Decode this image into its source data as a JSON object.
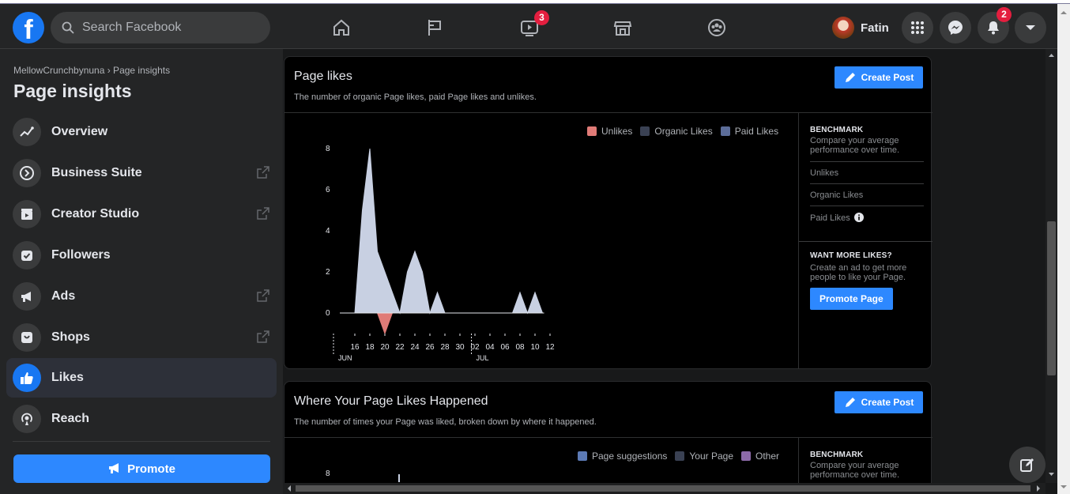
{
  "topbar": {
    "search_placeholder": "Search Facebook",
    "watch_badge": "3",
    "profile_name": "Fatin",
    "notifications_badge": "2"
  },
  "sidebar": {
    "breadcrumb": "MellowCrunchbynuna › Page insights",
    "title": "Page insights",
    "items": [
      {
        "label": "Overview"
      },
      {
        "label": "Business Suite"
      },
      {
        "label": "Creator Studio"
      },
      {
        "label": "Followers"
      },
      {
        "label": "Ads"
      },
      {
        "label": "Shops"
      },
      {
        "label": "Likes"
      },
      {
        "label": "Reach"
      }
    ],
    "promote_label": "Promote"
  },
  "page_likes_card": {
    "title": "Page likes",
    "subtitle": "The number of organic Page likes, paid Page likes and unlikes.",
    "create_post_label": "Create Post",
    "legend": [
      "Unlikes",
      "Organic Likes",
      "Paid Likes"
    ],
    "benchmark": {
      "heading": "BENCHMARK",
      "desc": "Compare your average performance over time.",
      "rows": [
        "Unlikes",
        "Organic Likes",
        "Paid Likes"
      ]
    },
    "more_likes": {
      "heading": "WANT MORE LIKES?",
      "desc": "Create an ad to get more people to like your Page.",
      "button": "Promote Page"
    }
  },
  "where_likes_card": {
    "title": "Where Your Page Likes Happened",
    "subtitle": "The number of times your Page was liked, broken down by where it happened.",
    "create_post_label": "Create Post",
    "legend": [
      "Page suggestions",
      "Your Page",
      "Other"
    ],
    "benchmark": {
      "heading": "BENCHMARK",
      "desc": "Compare your average performance over time."
    },
    "y_tick_top": "8"
  },
  "chart_data": {
    "type": "area",
    "title": "Page likes",
    "x_tick_labels": [
      "16",
      "18",
      "20",
      "22",
      "24",
      "26",
      "28",
      "30",
      "02",
      "04",
      "06",
      "08",
      "10",
      "12"
    ],
    "month_labels": [
      "JUN",
      "JUL"
    ],
    "yticks": [
      "0",
      "2",
      "4",
      "6",
      "8"
    ],
    "ylim": [
      -1,
      8.5
    ],
    "x": [
      "Jun 14",
      "Jun 15",
      "Jun 16",
      "Jun 17",
      "Jun 18",
      "Jun 19",
      "Jun 20",
      "Jun 21",
      "Jun 22",
      "Jun 23",
      "Jun 24",
      "Jun 25",
      "Jun 26",
      "Jun 27",
      "Jun 28",
      "Jun 29",
      "Jun 30",
      "Jul 01",
      "Jul 02",
      "Jul 03",
      "Jul 04",
      "Jul 05",
      "Jul 06",
      "Jul 07",
      "Jul 08",
      "Jul 09",
      "Jul 10",
      "Jul 11"
    ],
    "series": [
      {
        "name": "Organic Likes",
        "color": "#c8d0e2",
        "values": [
          0,
          0,
          0,
          5,
          8,
          3,
          2,
          1,
          0,
          2,
          3,
          2,
          0,
          1,
          0,
          0,
          0,
          0,
          0,
          0,
          0,
          0,
          0,
          0,
          1,
          0,
          1,
          0
        ]
      },
      {
        "name": "Unlikes",
        "color": "#e07b77",
        "values": [
          0,
          0,
          0,
          0,
          0,
          0,
          -1,
          0,
          0,
          0,
          0,
          0,
          0,
          0,
          0,
          0,
          0,
          0,
          0,
          0,
          0,
          0,
          0,
          0,
          0,
          0,
          0,
          0
        ]
      },
      {
        "name": "Paid Likes",
        "color": "#5c6d99",
        "values": [
          0,
          0,
          0,
          0,
          0,
          0,
          0,
          0,
          0,
          0,
          0,
          0,
          0,
          0,
          0,
          0,
          0,
          0,
          0,
          0,
          0,
          0,
          0,
          0,
          0,
          0,
          0,
          0
        ]
      }
    ],
    "legend_colors": {
      "Unlikes": "#e07b77",
      "Organic Likes": "#3a4153",
      "Paid Likes": "#5c6d99"
    },
    "legend_position": "top-right",
    "grid": false
  },
  "chart_data_2": {
    "legend_colors": {
      "Page suggestions": "#5c7ab5",
      "Your Page": "#3a4153",
      "Other": "#8c6aa8"
    }
  }
}
